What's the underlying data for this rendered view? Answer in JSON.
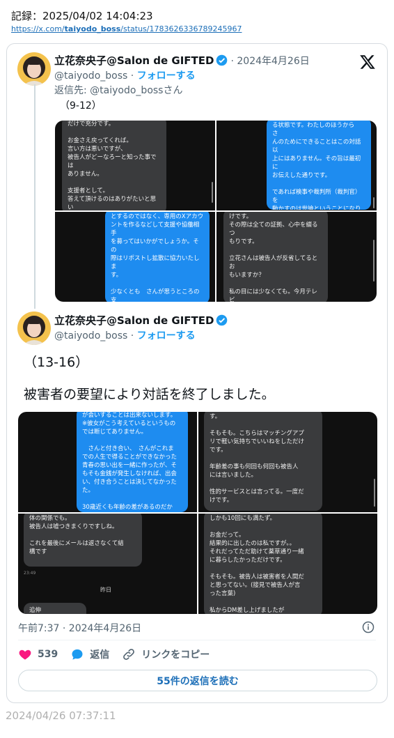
{
  "record": {
    "label": "記録：2025/04/02 14:04:23",
    "url_prefix": "https://x.com/",
    "url_user": "taiyodo_boss",
    "url_suffix": "/status/1783626336789245967"
  },
  "quoted_tweet": {
    "display_name": "立花奈央子@Salon de GIFTED",
    "date": "· 2024年4月26日",
    "handle": "@taiyodo_boss ·",
    "follow": "フォローする",
    "reply_to": "返信先: @taiyodo_bossさん",
    "text": "（9-12）",
    "images": [
      {
        "bubble": "だけで充分です。\n\nお金さえ戻ってくれば。\n言い方は悪いですが、\n被告人がどーなろーと知った事では\nありません。\n\n支援者として。\n答えて頂けるのはありがたいと思い\nます。\n\nもし本当に遺憾を表明したいなら"
      },
      {
        "bubble": "る状態です。わたしのほうから　さ\nんのためにできることはこの対話以\n上にはありません。その旨は最初に\nお伝えした通りです。\n\nであれば検事や裁判所（裁判官）を\n動かすのは世論ということになりま\nすが、これは被害者の状況を強く世\n間に対して発信することが必要でし\nょう。自分の言葉で声を上げ続けれ\nば、同情や同意意見が多く集まり、"
      },
      {
        "bubble": "とするのではなく、専用のXアカウ\nントを作るなどして支援や協働相手\nを募ってはいかがでしょうか。その\n際はリポストし拡散に協力いたしま\nす。\n\n少なくとも　さんが思うところの支\n援者としての義務は、わたしの負う\nものではないと考えています。それ\nに疑義のある場合は、支援者を非難\nするものとしてXや記事で書いてい"
      },
      {
        "bubble": "けです。\nその際は全ての証拠、心中を綴るつ\nもりです。\n\n立花さんは被告人が反省してるとお\nもいますか？\n\n私の目には少なくても。今月テレビ\n局が被告人に接見したときまでは反\n省してる様子は一切感じられません\nでした。"
      }
    ]
  },
  "main_tweet": {
    "display_name": "立花奈央子@Salon de GIFTED",
    "handle": "@taiyodo_boss ·",
    "follow": "フォローする",
    "line1": "（13-16）",
    "line2": "被害者の要望により対話を終了しました。",
    "images": [
      {
        "bubble": "が会いすることは出来ないします。\n※彼女がこう考えているというもの\nでは断じてありません。\n\n　さんと付き合い、　さんがこれま\nでの人生で得ることができなかった\n青春の思い出を一緒に作ったが、そ\nもそも金銭が発生しなければ、出会\nい、付き合うことは決してなかった\nた。\n\n30歳近くも年齢の差があるのだか"
      },
      {
        "bubble": "す。\n\nそもそも。こちらはマッチングアプ\nリで軽い気持ちでいいねをしただけ\nです。\n\n年齢差の事も何回も何回も被告人\nには言いました。\n\n性的サービスとは言ってる。一度だ\nけです。"
      },
      {
        "bubble": "体の関係でも。\n被告人は嘘つきまくりですしね。\n\nこれを最後にメールは返さなくて結\n構です",
        "time": "23:49",
        "day": "昨日",
        "tail": "追伸"
      },
      {
        "bubble": "しかも10回にも満たず。\n\nお金だって。\n結果的に出したのは私ですが。。\nそれだってただ助けて薬草通り一緒\nに暮らしたかっただけです。\n\nそもそも。被告人は被害者を人間だ\nと思ってない。(接見で被告人が言\nった言葉)\n\n私からDM差し上げましたが"
      }
    ]
  },
  "footer": {
    "timestamp": "午前7:37 · 2024年4月26日",
    "likes": "539",
    "reply_label": "返信",
    "copy_link": "リンクをコピー",
    "read_replies": "55件の返信を読む"
  },
  "archive_timestamp": "2024/04/26 07:37:11",
  "colors": {
    "accent": "#1d9bf0",
    "like": "#f91880",
    "verified": "#1d9bf0"
  }
}
